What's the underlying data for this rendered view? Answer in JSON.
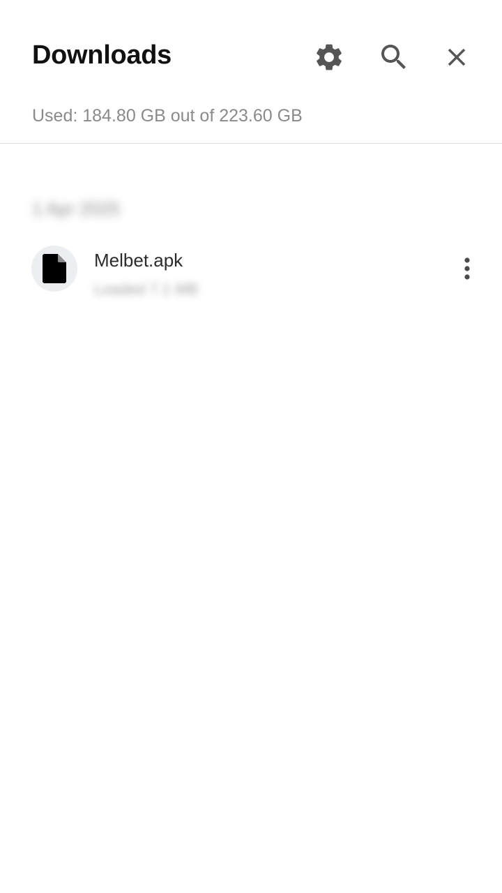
{
  "header": {
    "title": "Downloads",
    "storage_text": "Used: 184.80 GB out of 223.60 GB",
    "actions": [
      {
        "name": "settings",
        "icon": "gear-icon"
      },
      {
        "name": "search",
        "icon": "search-icon"
      },
      {
        "name": "close",
        "icon": "close-icon"
      }
    ]
  },
  "list": {
    "section_date": "1 Apr 2025",
    "items": [
      {
        "file_name": "Melbet.apk",
        "meta": "Loaded 7.1 MB",
        "icon": "file-icon",
        "menu_icon": "more-vert-icon"
      }
    ]
  },
  "colors": {
    "title": "#111111",
    "icon": "#555555",
    "secondary_text": "#8a8a8a",
    "divider": "#dcdcdc",
    "avatar_bg": "#eceef1"
  }
}
